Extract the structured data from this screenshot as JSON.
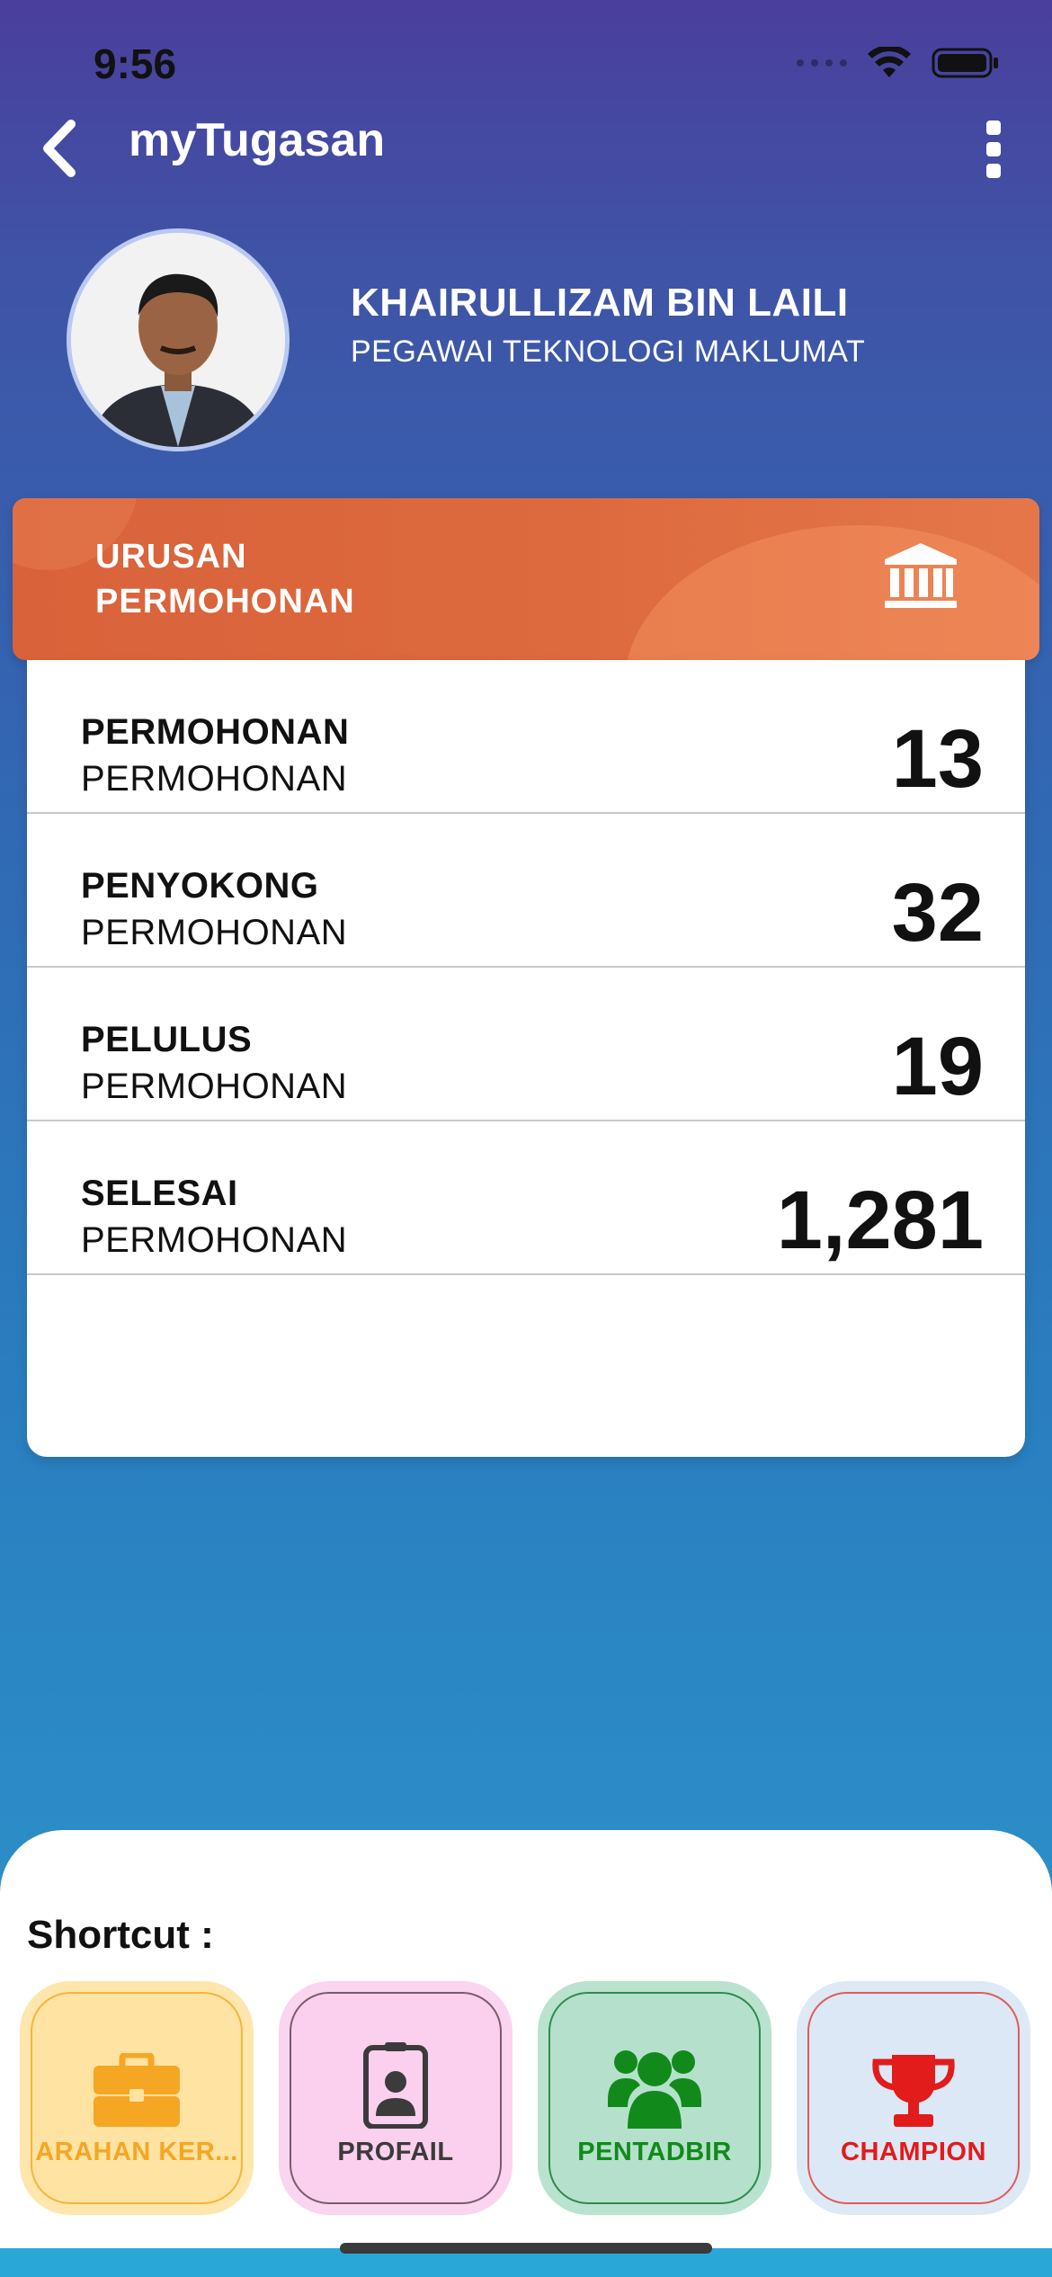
{
  "status_bar": {
    "time": "9:56"
  },
  "header": {
    "title": "myTugasan"
  },
  "profile": {
    "name": "KHAIRULLIZAM BIN LAILI",
    "role": "PEGAWAI TEKNOLOGI MAKLUMAT"
  },
  "section": {
    "title": "URUSAN PERMOHONAN",
    "icon": "bank-icon"
  },
  "stats": [
    {
      "title": "PERMOHONAN",
      "subtitle": "PERMOHONAN",
      "value": "13"
    },
    {
      "title": "PENYOKONG",
      "subtitle": "PERMOHONAN",
      "value": "32"
    },
    {
      "title": "PELULUS",
      "subtitle": "PERMOHONAN",
      "value": "19"
    },
    {
      "title": "SELESAI",
      "subtitle": "PERMOHONAN",
      "value": "1,281"
    }
  ],
  "shortcuts": {
    "label": "Shortcut :",
    "items": [
      {
        "label": "ARAHAN KER...",
        "icon": "briefcase-icon",
        "color": "#f5a623",
        "bg": "#ffe3a3",
        "border": "#f5b536"
      },
      {
        "label": "PROFAIL",
        "icon": "id-badge-icon",
        "color": "#3b3b3b",
        "bg": "#fbd0ee",
        "border": "#7a5a6e"
      },
      {
        "label": "PENTADBIR",
        "icon": "users-icon",
        "color": "#118a1b",
        "bg": "#b5e1cc",
        "border": "#2f8a4c"
      },
      {
        "label": "CHAMPION",
        "icon": "trophy-icon",
        "color": "#e21b1b",
        "bg": "#dce8f5",
        "border": "#e05a5a"
      }
    ]
  }
}
